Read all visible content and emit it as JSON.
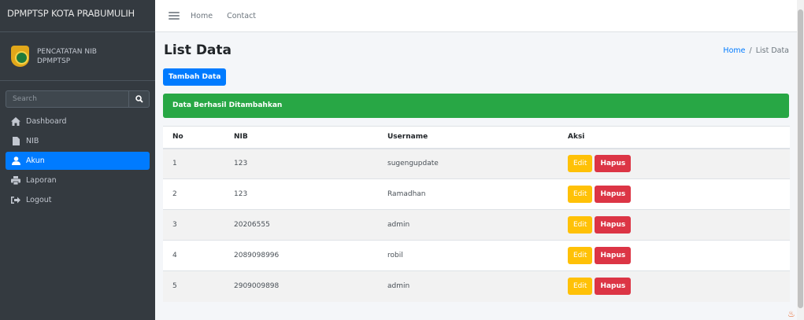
{
  "sidebar": {
    "brand": "DPMPTSP KOTA PRABUMULIH",
    "user": {
      "line1": "PENCATATAN NIB",
      "line2": "DPMPTSP"
    },
    "search_placeholder": "Search",
    "items": [
      {
        "label": "Dashboard",
        "icon": "home-icon"
      },
      {
        "label": "NIB",
        "icon": "file-icon"
      },
      {
        "label": "Akun",
        "icon": "user-icon",
        "active": true
      },
      {
        "label": "Laporan",
        "icon": "print-icon"
      },
      {
        "label": "Logout",
        "icon": "sign-out-icon"
      }
    ]
  },
  "topbar": {
    "home": "Home",
    "contact": "Contact"
  },
  "page": {
    "title": "List Data",
    "breadcrumb": {
      "home": "Home",
      "sep": "/",
      "current": "List Data"
    },
    "add_button": "Tambah Data",
    "alert": "Data Berhasil Ditambahkan"
  },
  "table": {
    "headers": [
      "No",
      "NIB",
      "Username",
      "Aksi"
    ],
    "edit_label": "Edit",
    "delete_label": "Hapus",
    "rows": [
      {
        "no": "1",
        "nib": "123",
        "username": "sugengupdate"
      },
      {
        "no": "2",
        "nib": "123",
        "username": "Ramadhan"
      },
      {
        "no": "3",
        "nib": "20206555",
        "username": "admin"
      },
      {
        "no": "4",
        "nib": "2089098996",
        "username": "robil"
      },
      {
        "no": "5",
        "nib": "2909009898",
        "username": "admin"
      }
    ]
  },
  "colors": {
    "sidebar": "#343a40",
    "primary": "#007bff",
    "success": "#28a745",
    "warning": "#ffc107",
    "danger": "#dc3545"
  }
}
